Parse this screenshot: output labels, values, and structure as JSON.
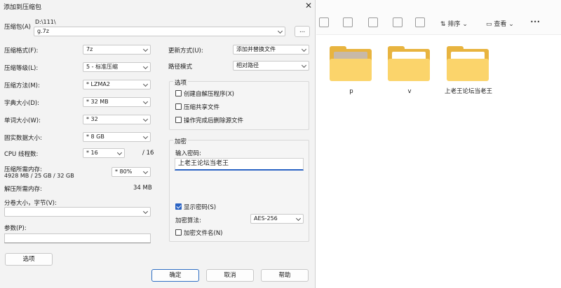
{
  "dialog": {
    "title": "添加到压缩包",
    "close_glyph": "✕",
    "archive": {
      "label": "压缩包(A)",
      "path": "D:\\111\\",
      "filename": "g.7z",
      "browse": "..."
    },
    "format": {
      "label": "压缩格式(F):",
      "value": "7z"
    },
    "level": {
      "label": "压缩等级(L):",
      "value": "5 - 标准压缩"
    },
    "method": {
      "label": "压缩方法(M):",
      "value": "* LZMA2"
    },
    "dict": {
      "label": "字典大小(D):",
      "value": "* 32 MB"
    },
    "word": {
      "label": "单词大小(W):",
      "value": "* 32"
    },
    "solid": {
      "label": "固实数据大小:",
      "value": "* 8 GB"
    },
    "cpu": {
      "label": "CPU 线程数:",
      "value": "* 16",
      "total": "/ 16"
    },
    "memory": {
      "label": "压缩所需内存:",
      "detail": "4928 MB / 25 GB / 32 GB",
      "value": "* 80%"
    },
    "decomp": {
      "label": "解压所需内存:",
      "value": "34 MB"
    },
    "split": {
      "label": "分卷大小，字节(V):",
      "value": ""
    },
    "params": {
      "label": "参数(P):",
      "value": ""
    },
    "options_button": "选项",
    "update": {
      "label": "更新方式(U):",
      "value": "添加并替换文件"
    },
    "pathmode": {
      "label": "路径模式",
      "value": "相对路径"
    },
    "options_group": {
      "title": "选项",
      "items": [
        {
          "label": "创建自解压程序(X)",
          "checked": false
        },
        {
          "label": "压缩共享文件",
          "checked": false
        },
        {
          "label": "操作完成后删除源文件",
          "checked": false
        }
      ]
    },
    "encrypt_group": {
      "title": "加密",
      "password_label": "输入密码:",
      "password_value": "上老王论坛当老王",
      "show_password": {
        "label": "显示密码(S)",
        "checked": true
      },
      "method_label": "加密算法:",
      "method_value": "AES-256",
      "encrypt_names": {
        "label": "加密文件名(N)",
        "checked": false
      }
    },
    "ok": "确定",
    "cancel": "取消",
    "help": "帮助"
  },
  "explorer": {
    "toolbar": {
      "sort": "排序",
      "view": "查看",
      "more": "•••"
    },
    "folders": [
      {
        "name": "p"
      },
      {
        "name": "v"
      },
      {
        "name": "上老王论坛当老王"
      }
    ]
  }
}
